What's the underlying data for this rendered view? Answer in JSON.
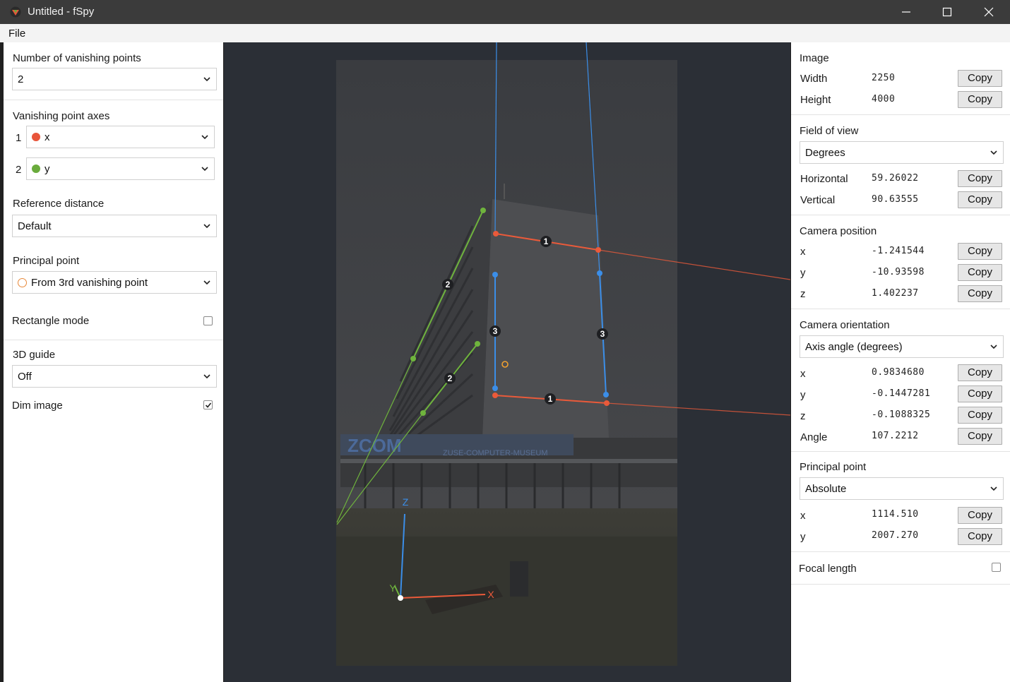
{
  "window": {
    "title": "Untitled - fSpy",
    "minimize_icon": "minimize-icon",
    "maximize_icon": "maximize-icon",
    "close_icon": "close-icon"
  },
  "menu": {
    "file": "File"
  },
  "left": {
    "vp_count": {
      "label": "Number of vanishing points",
      "value": "2"
    },
    "vp_axes": {
      "label": "Vanishing point axes",
      "items": [
        {
          "index": "1",
          "axis": "x",
          "color": "#e8553a"
        },
        {
          "index": "2",
          "axis": "y",
          "color": "#6aab3c"
        }
      ]
    },
    "ref_distance": {
      "label": "Reference distance",
      "value": "Default"
    },
    "principal_point": {
      "label": "Principal point",
      "value": "From 3rd vanishing point"
    },
    "rectangle_mode": {
      "label": "Rectangle mode",
      "checked": false
    },
    "guide_3d": {
      "label": "3D guide",
      "value": "Off"
    },
    "dim_image": {
      "label": "Dim image",
      "checked": true
    }
  },
  "viewport": {
    "segment_labels": {
      "x": "1",
      "y": "2",
      "z": "3"
    },
    "axis_labels": {
      "x": "X",
      "y": "Y",
      "z": "Z"
    },
    "colors": {
      "x": "#ea5a3a",
      "y": "#6fb43d",
      "z": "#3b8ee8",
      "principal": "#f0a030",
      "background": "#2b2f36"
    }
  },
  "right": {
    "image": {
      "title": "Image",
      "rows": [
        {
          "label": "Width",
          "value": "2250",
          "button": "Copy"
        },
        {
          "label": "Height",
          "value": "4000",
          "button": "Copy"
        }
      ]
    },
    "fov": {
      "title": "Field of view",
      "unit": "Degrees",
      "rows": [
        {
          "label": "Horizontal",
          "value": "59.26022",
          "button": "Copy"
        },
        {
          "label": "Vertical",
          "value": "90.63555",
          "button": "Copy"
        }
      ]
    },
    "cam_pos": {
      "title": "Camera position",
      "rows": [
        {
          "label": "x",
          "value": "-1.241544",
          "button": "Copy"
        },
        {
          "label": "y",
          "value": "-10.93598",
          "button": "Copy"
        },
        {
          "label": "z",
          "value": "1.402237",
          "button": "Copy"
        }
      ]
    },
    "cam_orient": {
      "title": "Camera orientation",
      "mode": "Axis angle (degrees)",
      "rows": [
        {
          "label": "x",
          "value": "0.9834680",
          "button": "Copy"
        },
        {
          "label": "y",
          "value": "-0.1447281",
          "button": "Copy"
        },
        {
          "label": "z",
          "value": "-0.1088325",
          "button": "Copy"
        },
        {
          "label": "Angle",
          "value": "107.2212",
          "button": "Copy"
        }
      ]
    },
    "pp": {
      "title": "Principal point",
      "mode": "Absolute",
      "rows": [
        {
          "label": "x",
          "value": "1114.510",
          "button": "Copy"
        },
        {
          "label": "y",
          "value": "2007.270",
          "button": "Copy"
        }
      ]
    },
    "focal": {
      "label": "Focal length",
      "checked": false
    }
  }
}
